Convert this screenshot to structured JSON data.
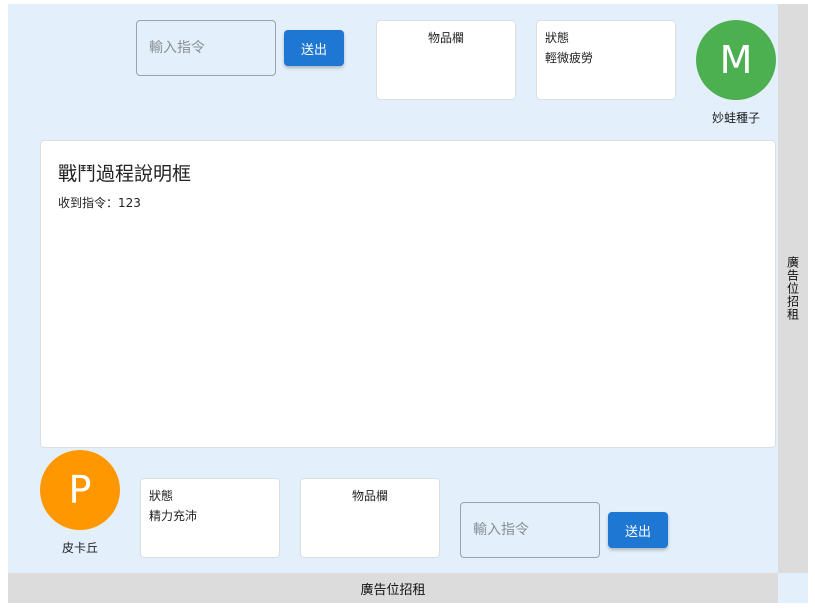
{
  "opponent": {
    "command_input": {
      "placeholder": "輸入指令",
      "value": ""
    },
    "send_label": "送出",
    "items_panel": {
      "title": "物品欄"
    },
    "status_panel": {
      "title": "狀態",
      "value": "輕微疲勞"
    },
    "avatar": {
      "letter": "M",
      "color": "#4caf50",
      "name": "妙蛙種子"
    }
  },
  "battle_log": {
    "title": "戰鬥過程說明框",
    "lines": [
      "收到指令：123"
    ]
  },
  "player": {
    "avatar": {
      "letter": "P",
      "color": "#ff9800",
      "name": "皮卡丘"
    },
    "status_panel": {
      "title": "狀態",
      "value": "精力充沛"
    },
    "items_panel": {
      "title": "物品欄"
    },
    "command_input": {
      "placeholder": "輸入指令",
      "value": ""
    },
    "send_label": "送出"
  },
  "ads": {
    "side": "廣告位招租",
    "bottom": "廣告位招租"
  }
}
